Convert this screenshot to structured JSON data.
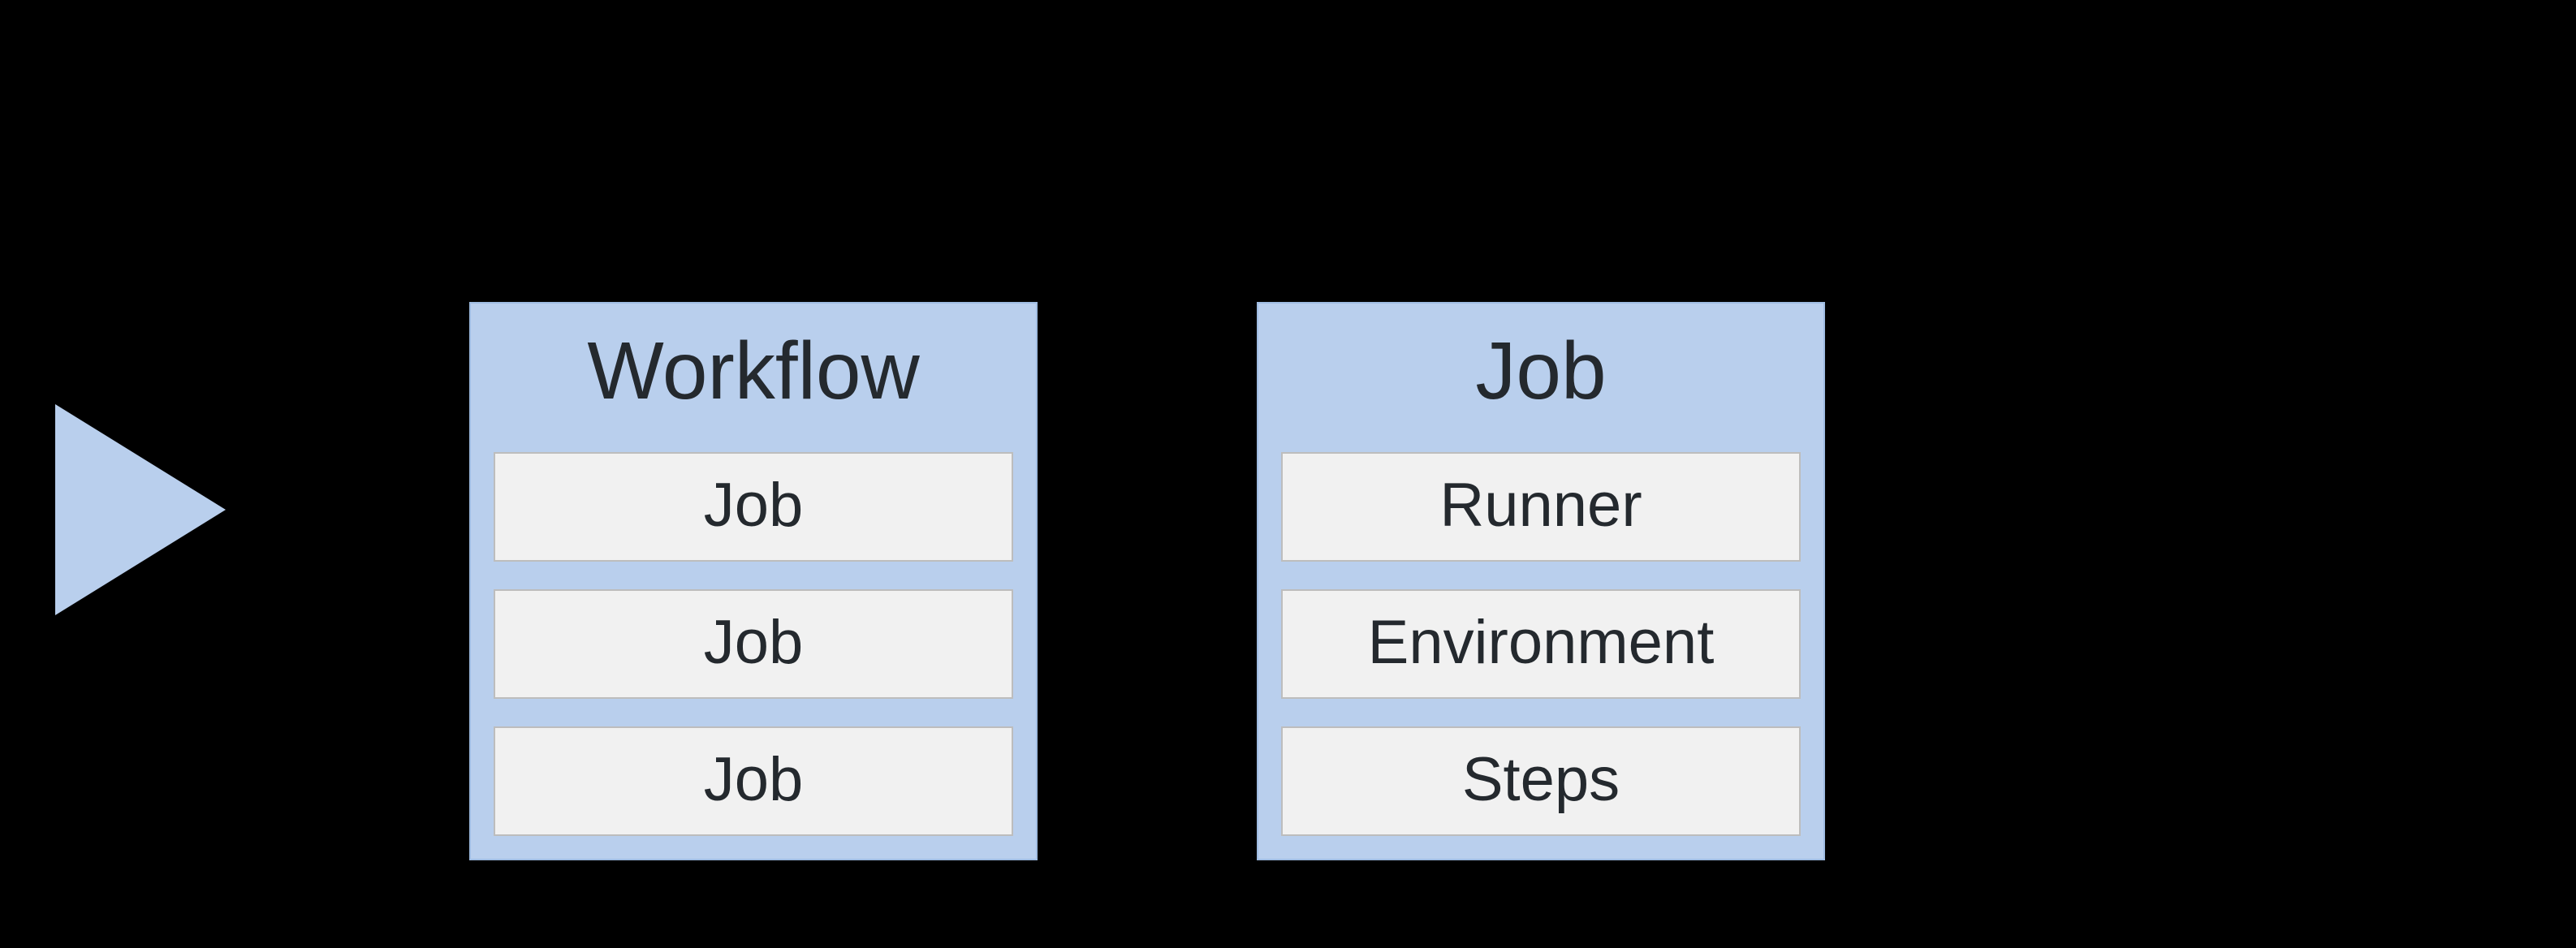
{
  "trigger": {
    "icon": "play-triangle"
  },
  "workflow": {
    "title": "Workflow",
    "items": [
      "Job",
      "Job",
      "Job"
    ]
  },
  "job": {
    "title": "Job",
    "items": [
      "Runner",
      "Environment",
      "Steps"
    ]
  }
}
